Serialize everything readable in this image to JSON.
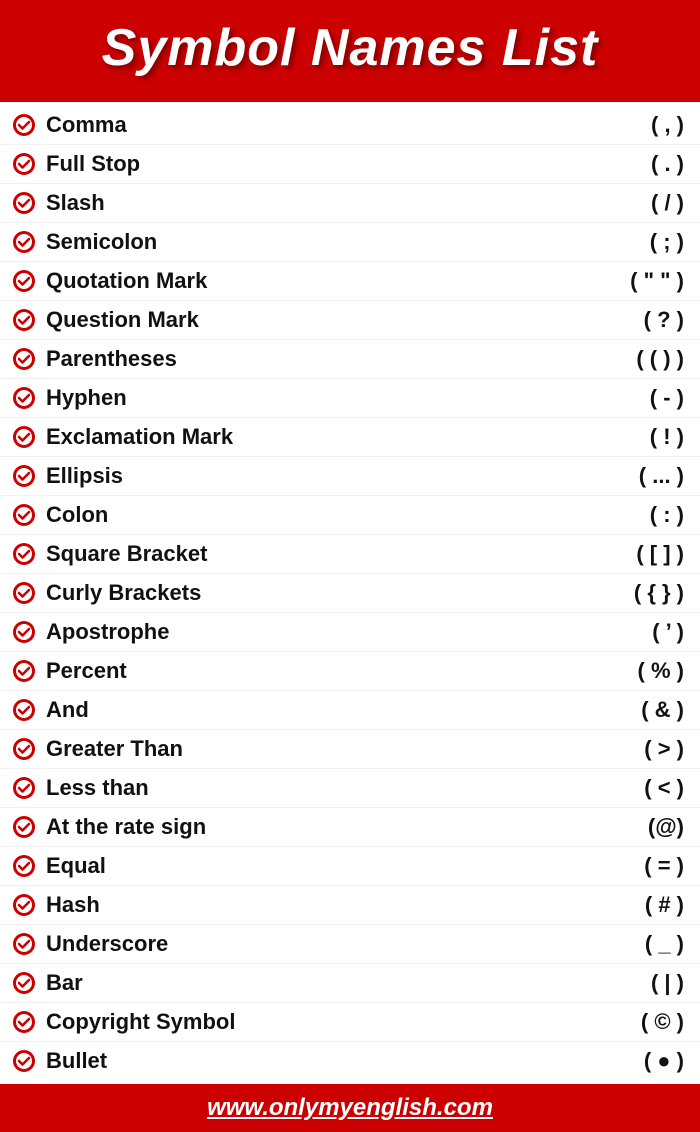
{
  "header": {
    "title": "Symbol Names List"
  },
  "symbols": [
    {
      "name": "Comma",
      "value": "( , )"
    },
    {
      "name": "Full Stop",
      "value": "( . )"
    },
    {
      "name": "Slash",
      "value": "( / )"
    },
    {
      "name": "Semicolon",
      "value": "( ; )"
    },
    {
      "name": "Quotation Mark",
      "value": "( \" \" )"
    },
    {
      "name": "Question Mark",
      "value": "( ? )"
    },
    {
      "name": "Parentheses",
      "value": "( ( ) )"
    },
    {
      "name": "Hyphen",
      "value": "( - )"
    },
    {
      "name": "Exclamation Mark",
      "value": "( ! )"
    },
    {
      "name": "Ellipsis",
      "value": "( ... )"
    },
    {
      "name": "Colon",
      "value": "( : )"
    },
    {
      "name": "Square Bracket",
      "value": "( [ ] )"
    },
    {
      "name": "Curly Brackets",
      "value": "( { } )"
    },
    {
      "name": "Apostrophe",
      "value": "( ’ )"
    },
    {
      "name": "Percent",
      "value": "( % )"
    },
    {
      "name": "And",
      "value": "( & )"
    },
    {
      "name": "Greater Than",
      "value": "( > )"
    },
    {
      "name": "Less than",
      "value": "( < )"
    },
    {
      "name": "At the rate sign",
      "value": "(@)"
    },
    {
      "name": "Equal",
      "value": "( = )"
    },
    {
      "name": "Hash",
      "value": "( # )"
    },
    {
      "name": "Underscore",
      "value": "( _ )"
    },
    {
      "name": "Bar",
      "value": "( | )"
    },
    {
      "name": "Copyright Symbol",
      "value": "( © )"
    },
    {
      "name": "Bullet",
      "value": "( ● )"
    }
  ],
  "footer": {
    "url": "www.onlymyenglish.com"
  }
}
